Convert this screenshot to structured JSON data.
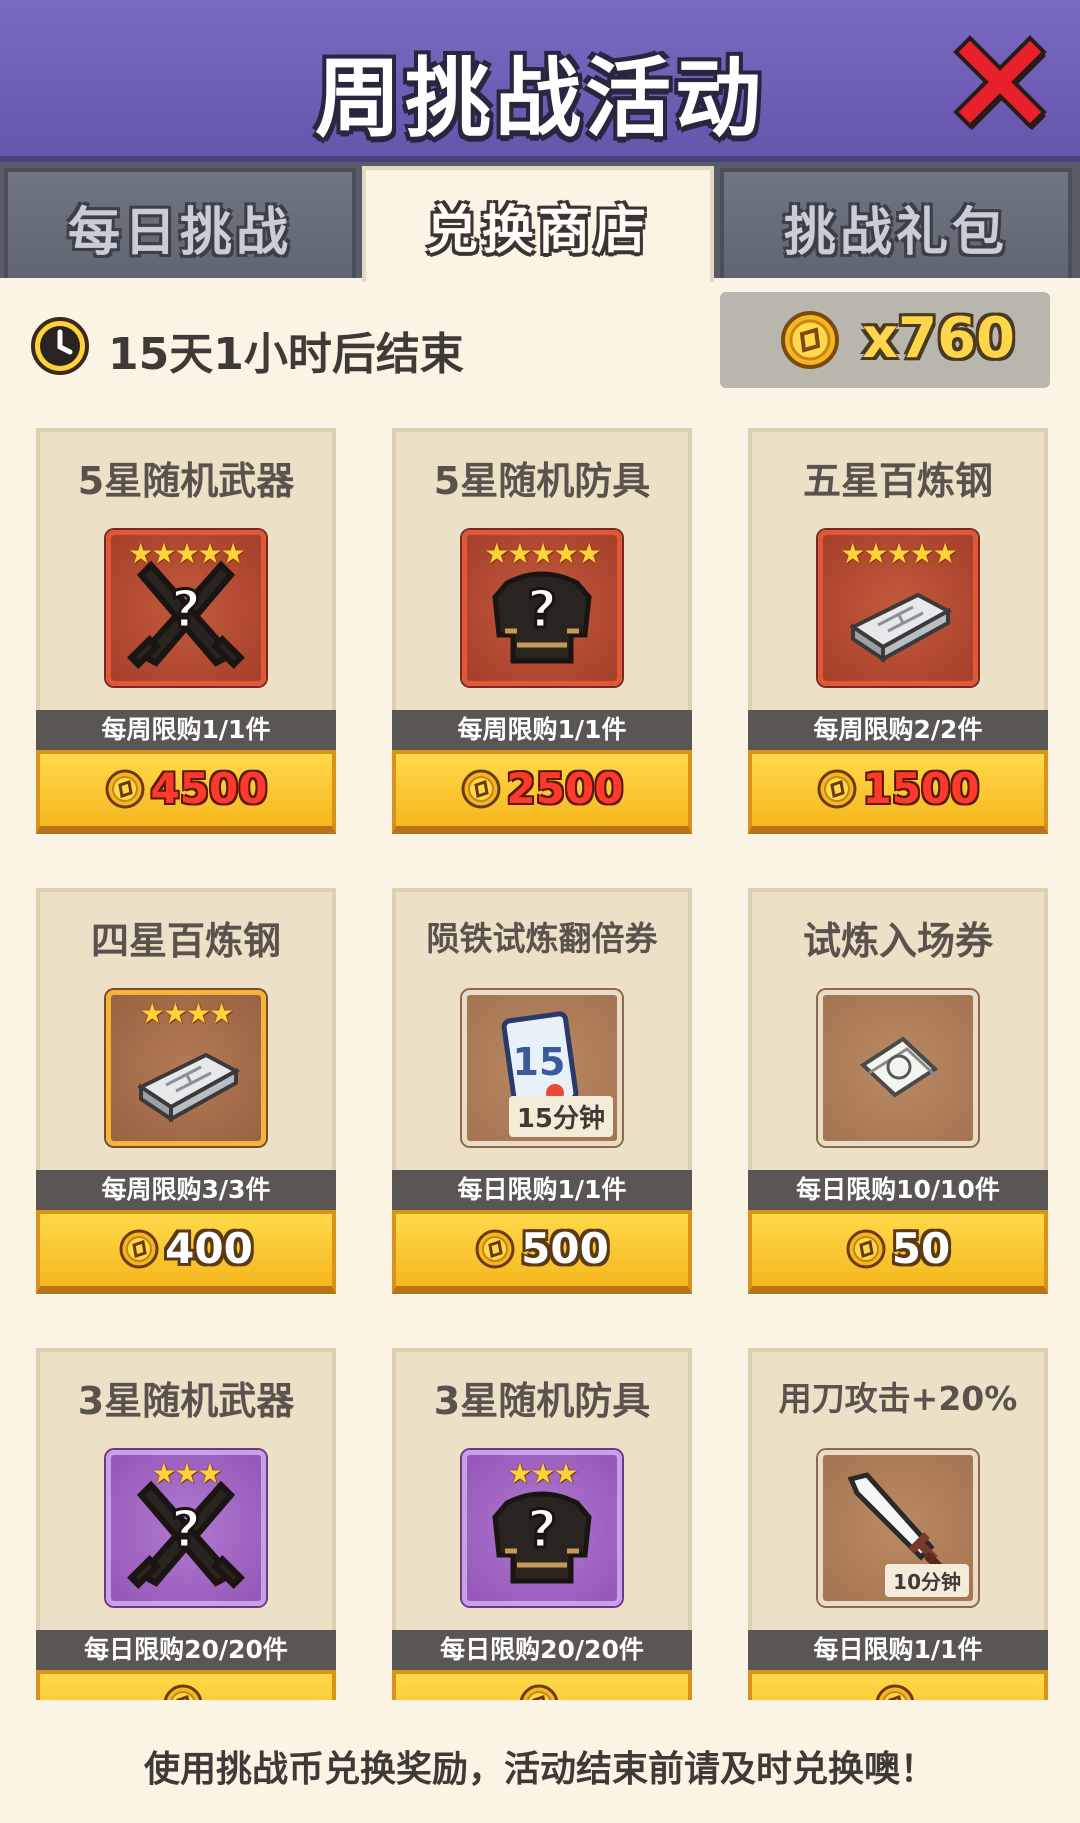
{
  "header": {
    "title": "周挑战活动"
  },
  "tabs": [
    {
      "label": "每日挑战",
      "active": false
    },
    {
      "label": "兑换商店",
      "active": true
    },
    {
      "label": "挑战礼包",
      "active": false
    }
  ],
  "info": {
    "time_left": "15天1小时后结束",
    "currency_amount": "x760"
  },
  "items": [
    {
      "name": "5星随机武器",
      "stars": "★★★★★",
      "icon": "random-weapon-icon",
      "frame": "red",
      "limit": "每周限购1/1件",
      "price": "4500",
      "price_red": true
    },
    {
      "name": "5星随机防具",
      "stars": "★★★★★",
      "icon": "random-armor-icon",
      "frame": "red",
      "limit": "每周限购1/1件",
      "price": "2500",
      "price_red": true
    },
    {
      "name": "五星百炼钢",
      "stars": "★★★★★",
      "icon": "steel-ingot-icon",
      "frame": "red",
      "limit": "每周限购2/2件",
      "price": "1500",
      "price_red": true
    },
    {
      "name": "四星百炼钢",
      "stars": "★★★★",
      "icon": "steel-ingot-icon",
      "frame": "gold",
      "limit": "每周限购3/3件",
      "price": "400",
      "price_red": false
    },
    {
      "name": "陨铁试炼翻倍券",
      "stars": "",
      "icon": "card-15-icon",
      "frame": "tan",
      "tag": "15分钟",
      "limit": "每日限购1/1件",
      "price": "500",
      "price_red": false
    },
    {
      "name": "试炼入场券",
      "stars": "",
      "icon": "ticket-scroll-icon",
      "frame": "tan",
      "limit": "每日限购10/10件",
      "price": "50",
      "price_red": false
    },
    {
      "name": "3星随机武器",
      "stars": "★★★",
      "icon": "random-weapon-icon",
      "frame": "purple",
      "limit": "每日限购20/20件",
      "price": "",
      "price_red": false
    },
    {
      "name": "3星随机防具",
      "stars": "★★★",
      "icon": "random-armor-icon",
      "frame": "purple",
      "limit": "每日限购20/20件",
      "price": "",
      "price_red": false
    },
    {
      "name": "用刀攻击+20%",
      "stars": "",
      "icon": "sword-icon",
      "frame": "tan",
      "tag": "10分钟",
      "limit": "每日限购1/1件",
      "price": "",
      "price_red": false
    }
  ],
  "footer": {
    "text": "使用挑战币兑换奖励，活动结束前请及时兑换噢！"
  }
}
